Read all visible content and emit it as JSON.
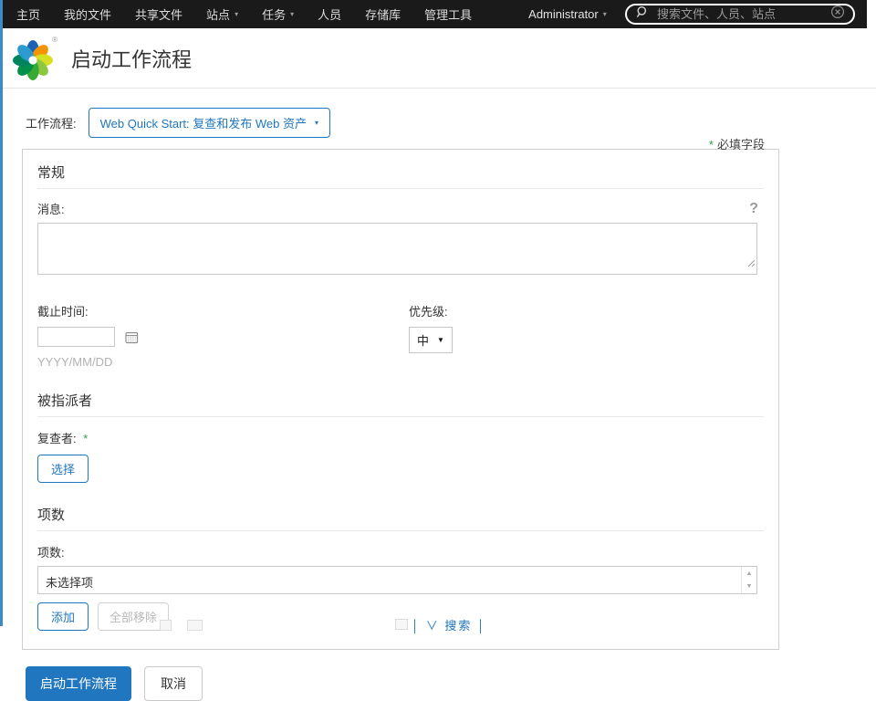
{
  "navbar": {
    "items": [
      {
        "label": "主页"
      },
      {
        "label": "我的文件"
      },
      {
        "label": "共享文件"
      },
      {
        "label": "站点"
      },
      {
        "label": "任务"
      },
      {
        "label": "人员"
      },
      {
        "label": "存储库"
      },
      {
        "label": "管理工具"
      }
    ],
    "user_menu_label": "Administrator",
    "search": {
      "placeholder": "搜索文件、人员、站点",
      "value": ""
    }
  },
  "header": {
    "title": "启动工作流程"
  },
  "workflow": {
    "label": "工作流程:",
    "selected": "Web Quick Start: 复查和发布 Web 资产"
  },
  "required_note": {
    "star": "*",
    "text": "必填字段"
  },
  "general": {
    "title": "常规",
    "message_label": "消息:",
    "message_value": "",
    "due_label": "截止时间:",
    "due_value": "",
    "due_hint": "YYYY/MM/DD",
    "priority_label": "优先级:",
    "priority_selected": "中"
  },
  "assignees": {
    "title": "被指派者",
    "reviewer_label": "复查者:",
    "required_star": "*",
    "select_button": "选择"
  },
  "items": {
    "title": "项数",
    "label": "项数:",
    "empty_text": "未选择项",
    "add_button": "添加",
    "remove_all_button": "全部移除"
  },
  "footer": {
    "start_button": "启动工作流程",
    "cancel_button": "取消",
    "clipped_text": "│ ∨ 搜索 │"
  },
  "icons": {
    "caret_down": "▾",
    "select_caret": "▼",
    "scroll_up": "▲",
    "scroll_down": "▼",
    "help": "?",
    "registered": "®"
  },
  "colors": {
    "accent_blue": "#2077bf",
    "nav_bg": "#1a1a1a",
    "required_green": "#2e9e4f",
    "page_edge_blue": "#3b8bc8"
  }
}
